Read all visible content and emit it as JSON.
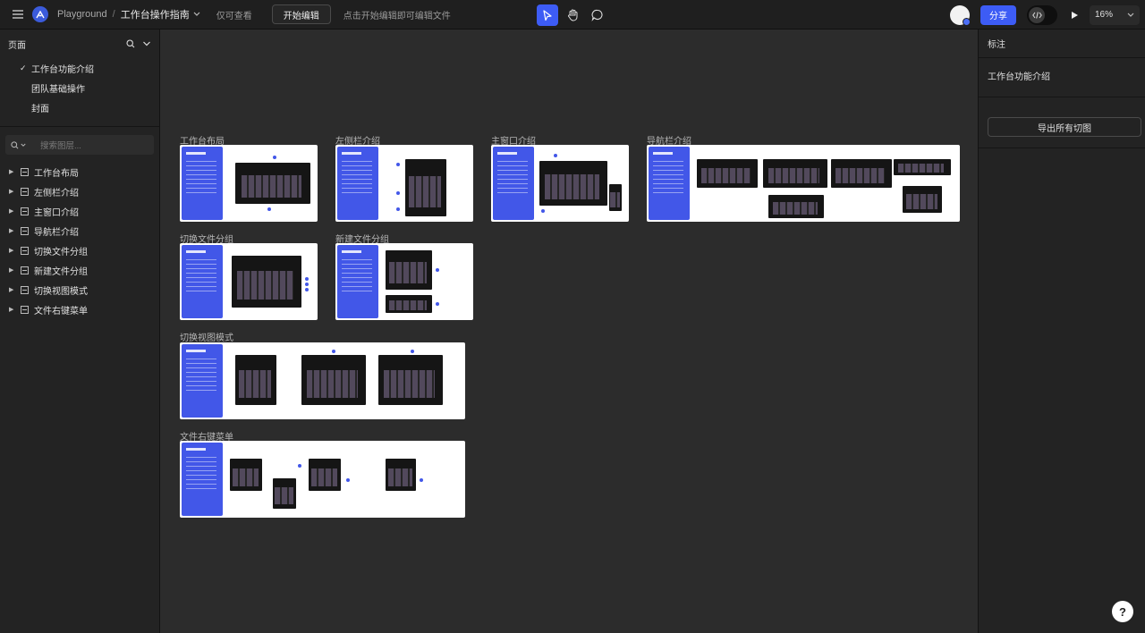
{
  "topbar": {
    "workspace": "Playground",
    "separator": "/",
    "doc_title": "工作台操作指南",
    "mode": "仅可查看",
    "start_edit": "开始编辑",
    "hint": "点击开始编辑即可编辑文件",
    "share": "分享",
    "zoom": "16%",
    "icons": [
      "menu-icon",
      "logo-icon",
      "chevron-down-icon",
      "cursor-icon",
      "hand-icon",
      "comment-icon",
      "code-icon",
      "play-icon"
    ]
  },
  "left_panel": {
    "pages_title": "页面",
    "pages": [
      {
        "label": "工作台功能介绍",
        "checked": true
      },
      {
        "label": "团队基础操作",
        "checked": false
      },
      {
        "label": "封面",
        "checked": false
      }
    ],
    "search_placeholder": "搜索图层...",
    "layers": [
      "工作台布局",
      "左侧栏介绍",
      "主窗口介绍",
      "导航栏介绍",
      "切换文件分组",
      "新建文件分组",
      "切换视图模式",
      "文件右键菜单"
    ]
  },
  "right_panel": {
    "title": "标注",
    "page_name": "工作台功能介绍",
    "export_label": "导出所有切图",
    "help": "?"
  },
  "canvas": {
    "frames": [
      {
        "label": "工作台布局"
      },
      {
        "label": "左侧栏介绍"
      },
      {
        "label": "主窗口介绍"
      },
      {
        "label": "导航栏介绍"
      },
      {
        "label": "切换文件分组"
      },
      {
        "label": "新建文件分组"
      },
      {
        "label": "切换视图模式"
      },
      {
        "label": "文件右键菜单"
      }
    ]
  },
  "colors": {
    "accent": "#3d5cf5",
    "frame_sidebar": "#4257e8",
    "canvas_bg": "#2c2c2c",
    "panel_bg": "#232323"
  }
}
